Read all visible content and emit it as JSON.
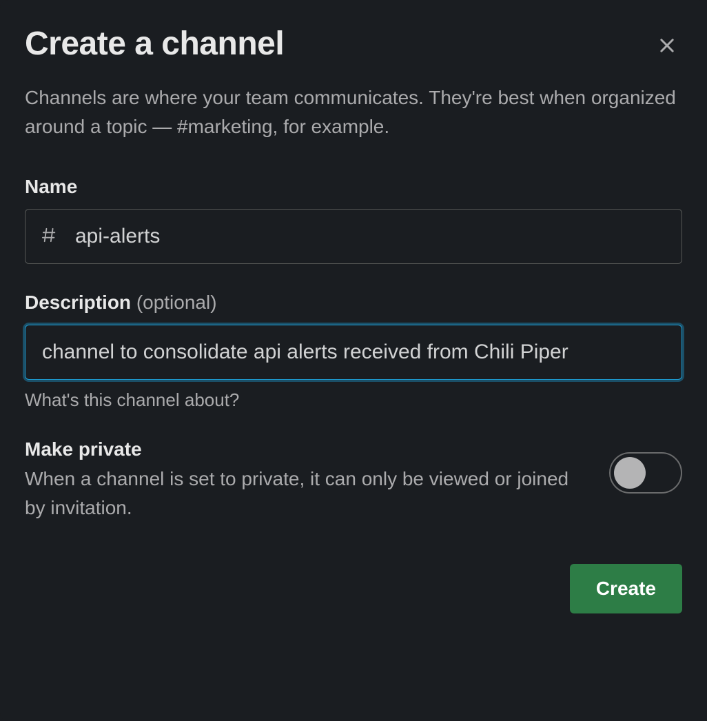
{
  "modal": {
    "title": "Create a channel",
    "description": "Channels are where your team communicates. They're best when organized around a topic — #marketing, for example."
  },
  "name_field": {
    "label": "Name",
    "value": "api-alerts",
    "prefix": "#"
  },
  "description_field": {
    "label": "Description",
    "optional_text": "(optional)",
    "value": "channel to consolidate api alerts received from Chili Piper",
    "help_text": "What's this channel about?"
  },
  "private": {
    "title": "Make private",
    "description": "When a channel is set to private, it can only be viewed or joined by invitation.",
    "enabled": false
  },
  "buttons": {
    "create": "Create"
  }
}
